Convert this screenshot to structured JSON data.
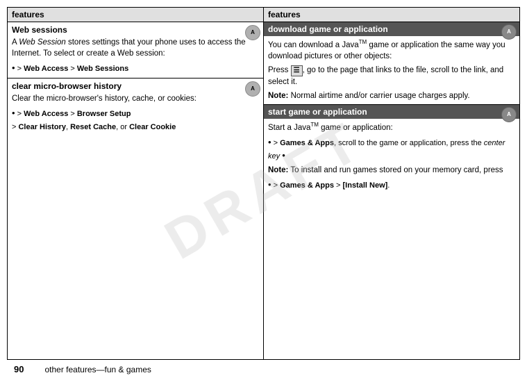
{
  "watermark": "DRAFT",
  "footer": {
    "page_number": "90",
    "label": "other features—fun & games"
  },
  "left_column": {
    "header": "features",
    "sections": [
      {
        "id": "web-sessions",
        "title": "Web sessions",
        "title_style": "normal",
        "has_icon": true,
        "body_lines": [
          {
            "type": "text",
            "parts": [
              {
                "text": "A ",
                "style": "normal"
              },
              {
                "text": "Web Session",
                "style": "italic"
              },
              {
                "text": " stores settings that your phone uses to access the Internet. To select or create a Web session:",
                "style": "normal"
              }
            ]
          },
          {
            "type": "nav",
            "parts": [
              {
                "text": "s",
                "style": "bullet"
              },
              {
                "text": " > ",
                "style": "normal"
              },
              {
                "text": "Web Access",
                "style": "bold"
              },
              {
                "text": " > ",
                "style": "normal"
              },
              {
                "text": "Web Sessions",
                "style": "bold"
              }
            ]
          }
        ]
      },
      {
        "id": "clear-micro-browser",
        "title": "clear micro-browser history",
        "title_style": "normal",
        "has_icon": true,
        "body_lines": [
          {
            "type": "text",
            "parts": [
              {
                "text": "Clear the micro-browser's history, cache, or cookies:",
                "style": "normal"
              }
            ]
          },
          {
            "type": "nav",
            "parts": [
              {
                "text": "s",
                "style": "bullet"
              },
              {
                "text": " > ",
                "style": "normal"
              },
              {
                "text": "Web Access",
                "style": "bold"
              },
              {
                "text": " > ",
                "style": "normal"
              },
              {
                "text": "Browser Setup",
                "style": "bold"
              }
            ]
          },
          {
            "type": "nav2",
            "parts": [
              {
                "text": " > ",
                "style": "normal"
              },
              {
                "text": "Clear History",
                "style": "bold"
              },
              {
                "text": ", ",
                "style": "normal"
              },
              {
                "text": "Reset Cache",
                "style": "bold"
              },
              {
                "text": ", or ",
                "style": "normal"
              },
              {
                "text": "Clear Cookie",
                "style": "bold"
              }
            ]
          }
        ]
      }
    ]
  },
  "right_column": {
    "header": "features",
    "sections": [
      {
        "id": "download-game",
        "title": "download game or application",
        "title_style": "dark",
        "has_icon": true,
        "body_lines": [
          {
            "type": "text",
            "parts": [
              {
                "text": "You can download a Java™ game or application the same way you download pictures or other objects:",
                "style": "normal"
              }
            ]
          },
          {
            "type": "text",
            "parts": [
              {
                "text": "Press",
                "style": "normal"
              },
              {
                "text": " ",
                "style": "normal"
              },
              {
                "text": "M",
                "style": "menu-key"
              },
              {
                "text": ", go to the page that links to the file, scroll to the link, and select it.",
                "style": "normal"
              }
            ]
          },
          {
            "type": "note",
            "parts": [
              {
                "text": "Note:",
                "style": "bold"
              },
              {
                "text": " Normal airtime and/or carrier usage charges apply.",
                "style": "normal"
              }
            ]
          }
        ]
      },
      {
        "id": "start-game",
        "title": "start game or application",
        "title_style": "dark",
        "has_icon": true,
        "body_lines": [
          {
            "type": "text",
            "parts": [
              {
                "text": "Start a Java™ game or application:",
                "style": "normal"
              }
            ]
          },
          {
            "type": "nav",
            "parts": [
              {
                "text": "s",
                "style": "bullet"
              },
              {
                "text": " > ",
                "style": "normal"
              },
              {
                "text": "Games & Apps",
                "style": "bold"
              },
              {
                "text": ", scroll to the game or application, press the ",
                "style": "normal"
              },
              {
                "text": "center key",
                "style": "italic"
              },
              {
                "text": " s",
                "style": "bullet-inline"
              }
            ]
          },
          {
            "type": "note",
            "parts": [
              {
                "text": "Note:",
                "style": "bold"
              },
              {
                "text": " To install and run games stored on your memory card, press",
                "style": "normal"
              }
            ]
          },
          {
            "type": "nav",
            "parts": [
              {
                "text": "s",
                "style": "bullet"
              },
              {
                "text": " > ",
                "style": "normal"
              },
              {
                "text": "Games & Apps",
                "style": "bold"
              },
              {
                "text": " > ",
                "style": "normal"
              },
              {
                "text": "[Install New]",
                "style": "bold"
              },
              {
                "text": ".",
                "style": "normal"
              }
            ]
          }
        ]
      }
    ]
  }
}
